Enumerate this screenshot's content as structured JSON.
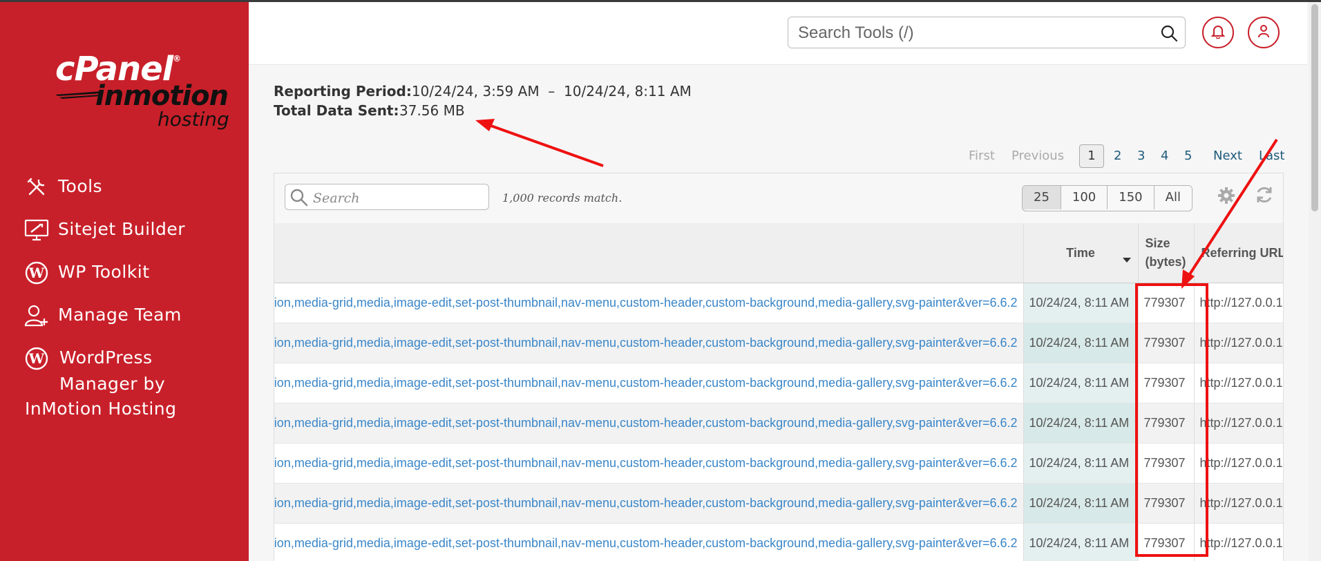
{
  "sidebar": {
    "logo": {
      "brand": "cPanel",
      "reg": "®",
      "partner": "inmotion",
      "partner_sub": "hosting"
    },
    "items": [
      {
        "label": "Tools",
        "icon": "tools-icon"
      },
      {
        "label": "Sitejet Builder",
        "icon": "sitejet-icon"
      },
      {
        "label": "WP Toolkit",
        "icon": "wordpress-icon"
      },
      {
        "label": "Manage Team",
        "icon": "manage-team-icon"
      },
      {
        "label_line1": "WordPress",
        "label_line2": "Manager by",
        "label_line3": "InMotion Hosting",
        "icon": "wordpress-icon"
      }
    ]
  },
  "header": {
    "search_placeholder": "Search Tools (/)",
    "icons": [
      "search-icon",
      "bell-icon",
      "user-icon"
    ]
  },
  "report": {
    "period_label": "Reporting Period:",
    "period_value": "10/24/24, 3:59 AM  –  10/24/24, 8:11 AM",
    "total_label": "Total Data Sent:",
    "total_value": "37.56 MB"
  },
  "pager": {
    "first": "First",
    "previous": "Previous",
    "pages": [
      "1",
      "2",
      "3",
      "4",
      "5"
    ],
    "current": "1",
    "next": "Next",
    "last": "Last"
  },
  "table_toolbar": {
    "search_placeholder": "Search",
    "records_text": "1,000 records match.",
    "page_sizes": [
      "25",
      "100",
      "150",
      "All"
    ],
    "active_size": "25"
  },
  "table": {
    "columns": [
      "",
      "Time",
      "Size\n(bytes)",
      "Referring URL"
    ],
    "rows": [
      {
        "url": "ion,media-grid,media,image-edit,set-post-thumbnail,nav-menu,custom-header,custom-background,media-gallery,svg-painter&ver=6.6.2",
        "time": "10/24/24, 8:11 AM",
        "size": "779307",
        "referrer": "http://127.0.0.1"
      },
      {
        "url": "ion,media-grid,media,image-edit,set-post-thumbnail,nav-menu,custom-header,custom-background,media-gallery,svg-painter&ver=6.6.2",
        "time": "10/24/24, 8:11 AM",
        "size": "779307",
        "referrer": "http://127.0.0.1"
      },
      {
        "url": "ion,media-grid,media,image-edit,set-post-thumbnail,nav-menu,custom-header,custom-background,media-gallery,svg-painter&ver=6.6.2",
        "time": "10/24/24, 8:11 AM",
        "size": "779307",
        "referrer": "http://127.0.0.1"
      },
      {
        "url": "ion,media-grid,media,image-edit,set-post-thumbnail,nav-menu,custom-header,custom-background,media-gallery,svg-painter&ver=6.6.2",
        "time": "10/24/24, 8:11 AM",
        "size": "779307",
        "referrer": "http://127.0.0.1"
      },
      {
        "url": "ion,media-grid,media,image-edit,set-post-thumbnail,nav-menu,custom-header,custom-background,media-gallery,svg-painter&ver=6.6.2",
        "time": "10/24/24, 8:11 AM",
        "size": "779307",
        "referrer": "http://127.0.0.1"
      },
      {
        "url": "ion,media-grid,media,image-edit,set-post-thumbnail,nav-menu,custom-header,custom-background,media-gallery,svg-painter&ver=6.6.2",
        "time": "10/24/24, 8:11 AM",
        "size": "779307",
        "referrer": "http://127.0.0.1"
      },
      {
        "url": "ion,media-grid,media,image-edit,set-post-thumbnail,nav-menu,custom-header,custom-background,media-gallery,svg-painter&ver=6.6.2",
        "time": "10/24/24, 8:11 AM",
        "size": "779307",
        "referrer": "http://127.0.0.1"
      }
    ]
  },
  "colors": {
    "brand_red": "#c8202a",
    "link_blue": "#3a86c8",
    "annotation_red": "#ee1111"
  }
}
